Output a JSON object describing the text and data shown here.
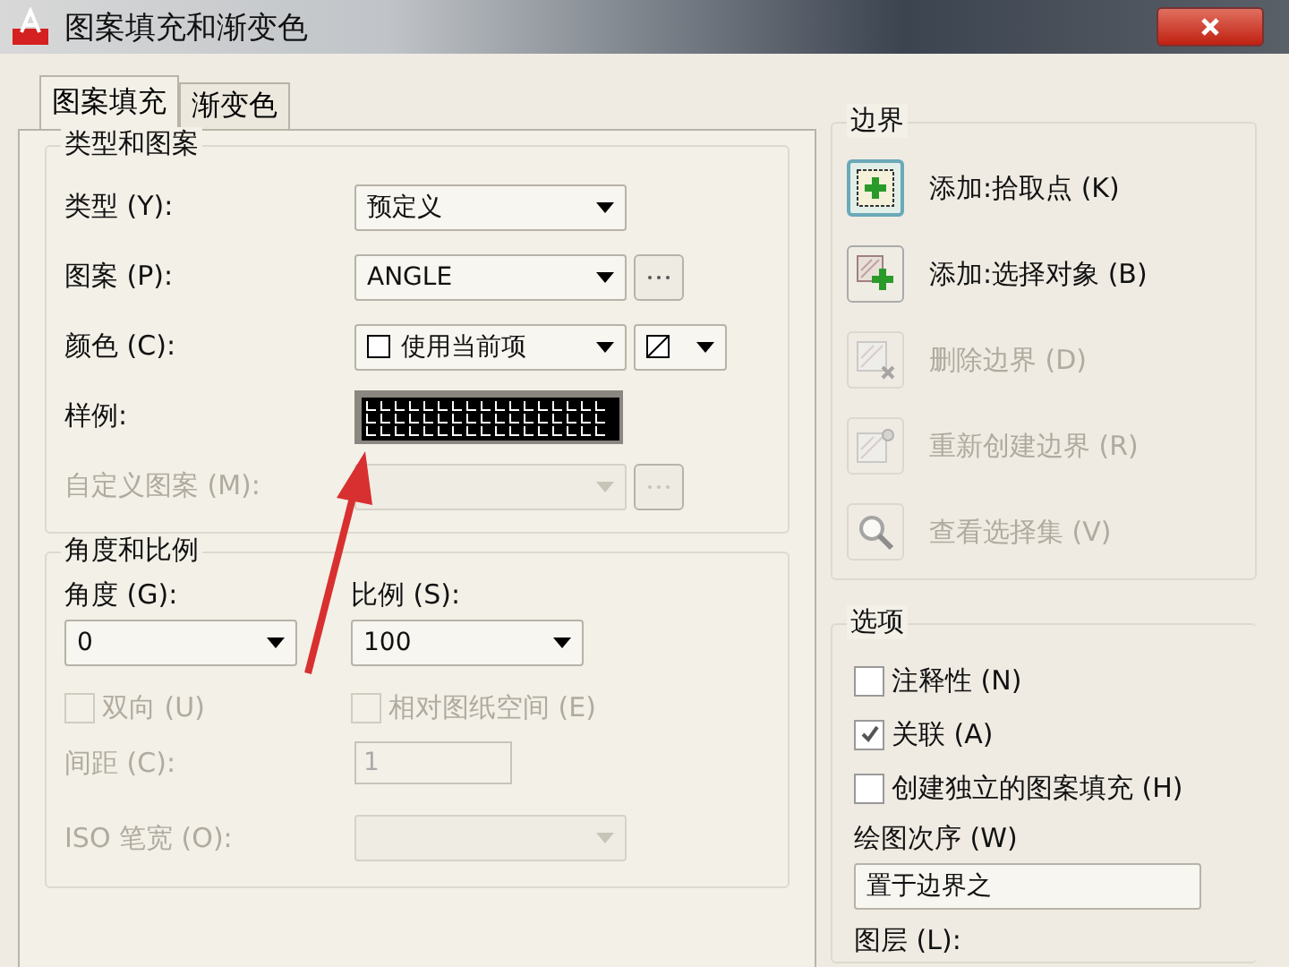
{
  "window": {
    "title": "图案填充和渐变色"
  },
  "tabs": [
    {
      "label": "图案填充",
      "selected": true
    },
    {
      "label": "渐变色",
      "selected": false
    }
  ],
  "type_pattern": {
    "title": "类型和图案",
    "rows": [
      {
        "kind": "dropdown",
        "label": "类型 (Y):",
        "value": "预定义",
        "disabled": false,
        "browse": false
      },
      {
        "kind": "dropdown",
        "label": "图案 (P):",
        "value": "ANGLE",
        "disabled": false,
        "browse": true
      },
      {
        "kind": "color",
        "label": "颜色 (C):",
        "value": "使用当前项",
        "disabled": false
      },
      {
        "kind": "swatch",
        "label": "样例:",
        "disabled": false
      },
      {
        "kind": "dropdown",
        "label": "自定义图案 (M):",
        "disabled": true,
        "browse": true
      }
    ]
  },
  "angle_scale": {
    "title": "角度和比例",
    "angle": {
      "label": "角度 (G):",
      "value": "0"
    },
    "scale": {
      "label": "比例 (S):",
      "value": "100"
    },
    "checks": [
      {
        "label": "双向 (U)",
        "checked": false,
        "disabled": true
      },
      {
        "label": "相对图纸空间 (E)",
        "checked": false,
        "disabled": true
      }
    ],
    "spacing": {
      "label": "间距 (C):",
      "value": "1",
      "disabled": true
    },
    "iso_pen": {
      "label": "ISO 笔宽 (O):",
      "disabled": true
    }
  },
  "boundary": {
    "title": "边界",
    "actions": [
      {
        "kind": "pick",
        "label": "添加:拾取点 (K)",
        "disabled": false,
        "selected": true
      },
      {
        "kind": "select",
        "label": "添加:选择对象 (B)",
        "disabled": false,
        "selected": false
      },
      {
        "kind": "remove",
        "label": "删除边界 (D)",
        "disabled": true,
        "selected": false
      },
      {
        "kind": "recreate",
        "label": "重新创建边界 (R)",
        "disabled": true,
        "selected": false
      },
      {
        "kind": "view",
        "label": "查看选择集 (V)",
        "disabled": true,
        "selected": false
      }
    ]
  },
  "options": {
    "title": "选项",
    "checks": [
      {
        "label": "注释性 (N)",
        "checked": false,
        "disabled": false
      },
      {
        "label": "关联 (A)",
        "checked": true,
        "disabled": false
      },
      {
        "label": "创建独立的图案填充 (H)",
        "checked": false,
        "disabled": false
      }
    ],
    "draw_order": {
      "label": "绘图次序 (W)",
      "value": "置于边界之"
    },
    "layer": {
      "label": "图层 (L):"
    }
  }
}
